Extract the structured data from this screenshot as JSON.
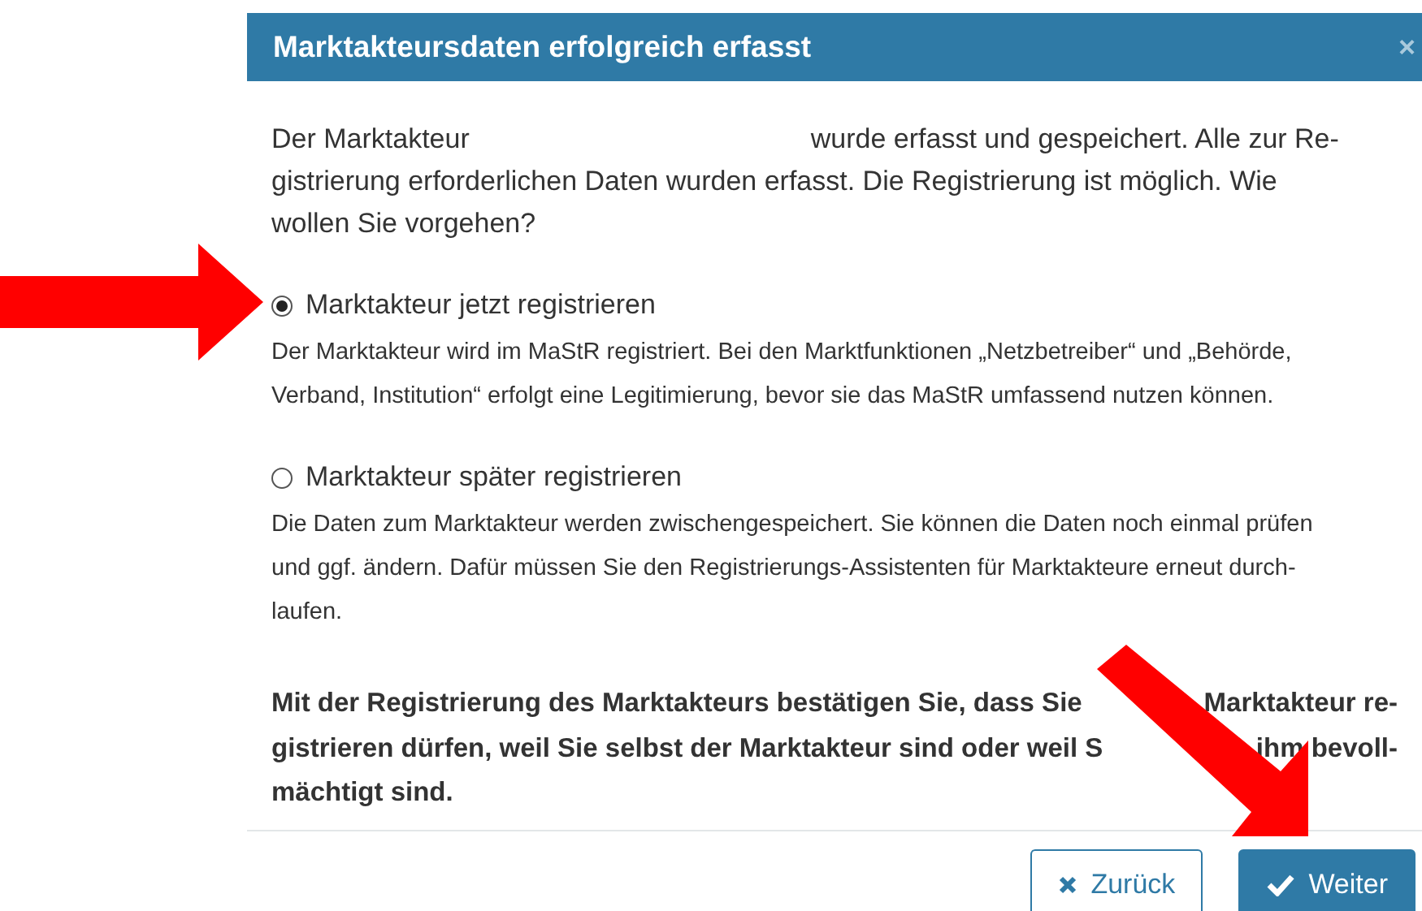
{
  "dialog": {
    "title": "Marktakteursdaten erfolgreich erfasst",
    "close": "×",
    "intro_lines": [
      [
        "Der Marktakteur",
        "wurde erfasst und gespeichert. Alle zur Re-"
      ],
      [
        "gistrierung erforderlichen Daten wurden erfasst. Die Registrierung ist möglich. Wie"
      ],
      [
        "wollen Sie vorgehen?"
      ]
    ],
    "options": [
      {
        "label": "Marktakteur jetzt registrieren",
        "selected": true,
        "description_lines": [
          "Der Marktakteur wird im MaStR registriert. Bei den Marktfunktionen „Netzbetreiber“ und „Behörde,",
          "Verband, Institution“ erfolgt eine Legitimierung, bevor sie das MaStR umfassend nutzen können."
        ]
      },
      {
        "label": "Marktakteur später registrieren",
        "selected": false,
        "description_lines": [
          "Die Daten zum Marktakteur werden zwischengespeichert. Sie können die Daten noch einmal prüfen",
          "und ggf. ändern. Dafür müssen Sie den Registrierungs-Assistenten für Marktakteure erneut durch-",
          "laufen."
        ]
      }
    ],
    "confirmation_lines": [
      [
        "Mit der Registrierung des Marktakteurs bestätigen Sie, dass Sie",
        "Marktakteur re-"
      ],
      [
        "gistrieren dürfen, weil Sie selbst der Marktakteur sind oder weil S",
        "ihm bevoll-"
      ],
      [
        "mächtigt sind."
      ]
    ],
    "buttons": [
      {
        "kind": "secondary",
        "label": "Zurück"
      },
      {
        "kind": "primary",
        "label": "Weiter"
      }
    ]
  }
}
